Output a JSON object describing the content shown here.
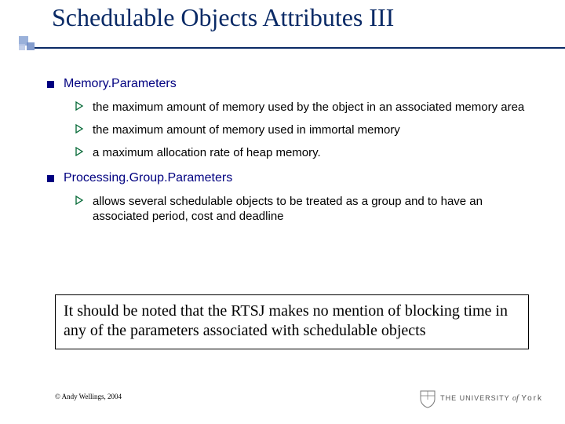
{
  "title": "Schedulable Objects Attributes III",
  "sections": [
    {
      "heading": "Memory.Parameters",
      "items": [
        "the maximum amount of memory used by the object in an associated memory area",
        "the maximum amount of memory used in immortal memory",
        "a maximum allocation rate of heap memory."
      ]
    },
    {
      "heading": "Processing.Group.Parameters",
      "items": [
        "allows several schedulable objects to be treated as a group and to have an associated period, cost and deadline"
      ]
    }
  ],
  "note": "It should be noted that the RTSJ makes no mention of blocking time in any of the parameters associated with schedulable objects",
  "copyright": "© Andy Wellings, 2004",
  "logo": {
    "prefix": "THE UNIVERSITY",
    "of": "of",
    "name": "York"
  },
  "colors": {
    "title": "#0a2a66",
    "heading": "#000080",
    "arrow": "#006633"
  }
}
